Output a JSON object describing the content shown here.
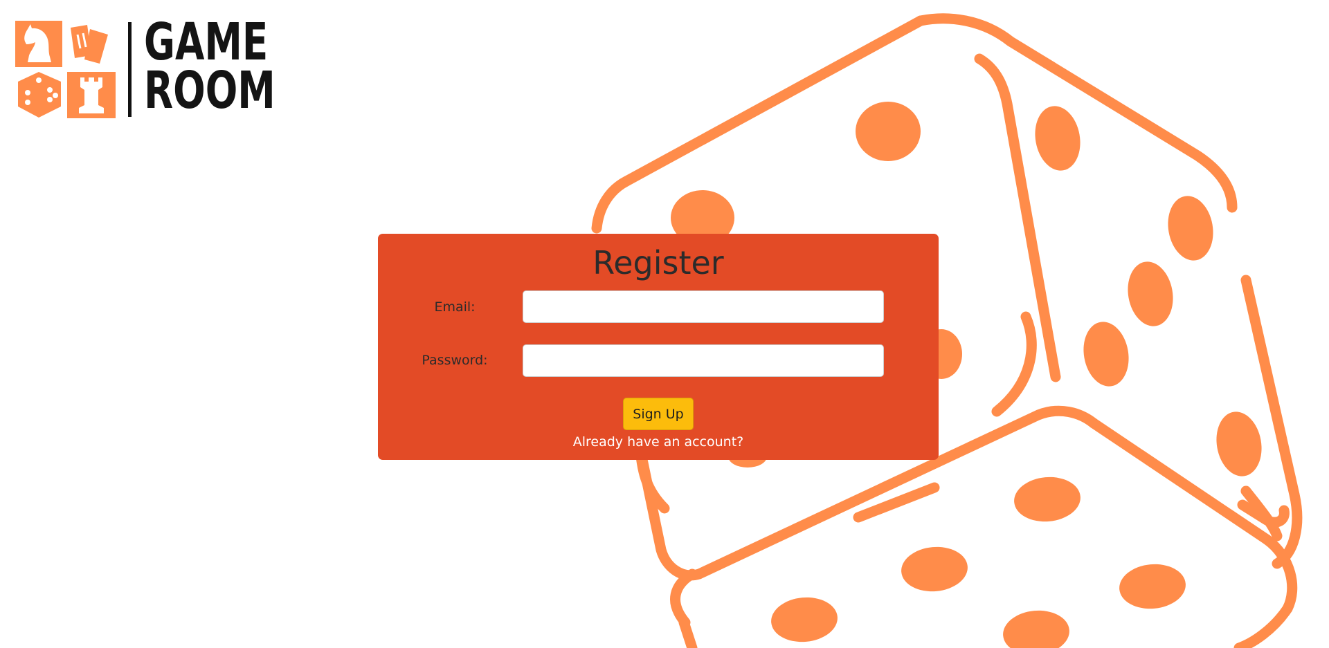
{
  "brand": {
    "name_line1": "GAME",
    "name_line2": "ROOM",
    "accent_color": "#ff8c4a"
  },
  "register_form": {
    "title": "Register",
    "email_label": "Email:",
    "email_value": "",
    "password_label": "Password:",
    "password_value": "",
    "submit_label": "Sign Up",
    "login_link": "Already have an account?",
    "card_color": "#e34b26",
    "button_color": "#fcbc0c"
  },
  "background": {
    "icon": "dice-icon",
    "color": "#ff8c4a"
  }
}
